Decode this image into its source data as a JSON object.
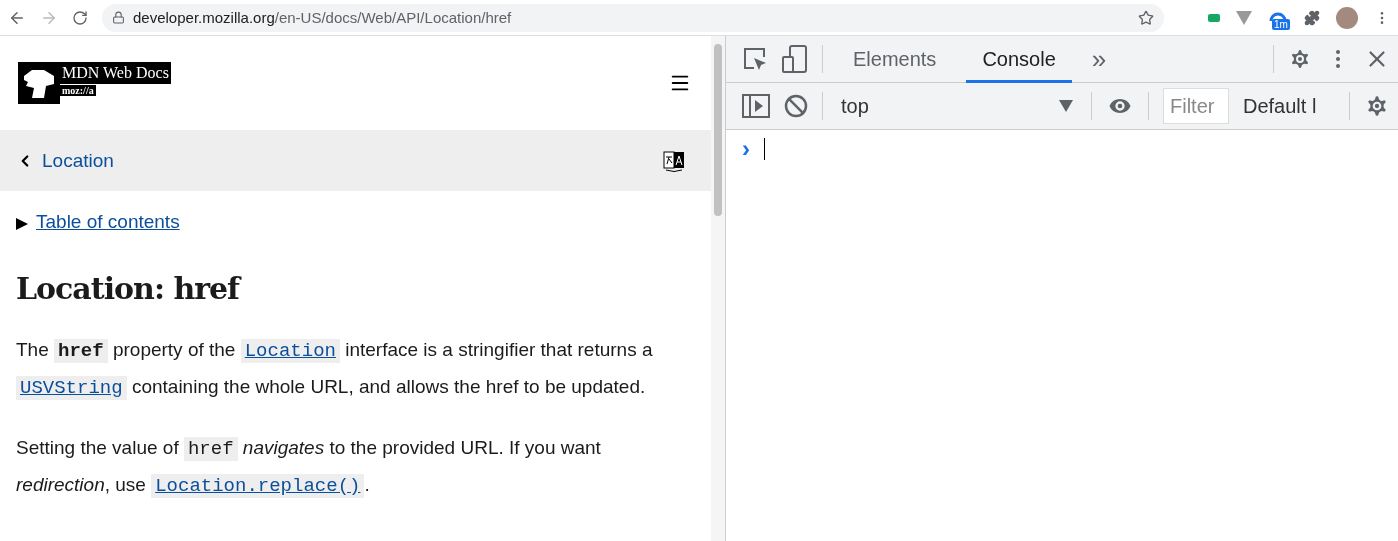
{
  "browser": {
    "url_host": "developer.mozilla.org",
    "url_path": "/en-US/docs/Web/API/Location/href",
    "extension_badge": "1m"
  },
  "page": {
    "logo_title": "MDN Web Docs",
    "logo_sub": "moz://a",
    "breadcrumb": "Location",
    "toc": "Table of contents",
    "heading": "Location: href",
    "paragraphs": [
      [
        {
          "kind": "text",
          "text": "The "
        },
        {
          "kind": "code",
          "text": "href",
          "bold": true
        },
        {
          "kind": "text",
          "text": " property of the "
        },
        {
          "kind": "link",
          "text": "Location"
        },
        {
          "kind": "text",
          "text": " interface is a stringifier that returns a "
        },
        {
          "kind": "link",
          "text": "USVString"
        },
        {
          "kind": "text",
          "text": " containing the whole URL, and allows the href to be updated."
        }
      ],
      [
        {
          "kind": "text",
          "text": "Setting the value of "
        },
        {
          "kind": "code",
          "text": "href",
          "bold": false
        },
        {
          "kind": "em",
          "text": " navigates"
        },
        {
          "kind": "text",
          "text": " to the provided URL. If you want "
        },
        {
          "kind": "em",
          "text": "redirection"
        },
        {
          "kind": "text",
          "text": ", use "
        },
        {
          "kind": "link",
          "text": "Location.replace()"
        },
        {
          "kind": "text",
          "text": "."
        }
      ]
    ]
  },
  "devtools": {
    "tabs": [
      {
        "label": "Elements",
        "selected": false
      },
      {
        "label": "Console",
        "selected": true
      }
    ],
    "more": "»",
    "context": "top",
    "filter": {
      "placeholder": "Filter"
    },
    "levels": "Default l",
    "prompt": "›"
  }
}
